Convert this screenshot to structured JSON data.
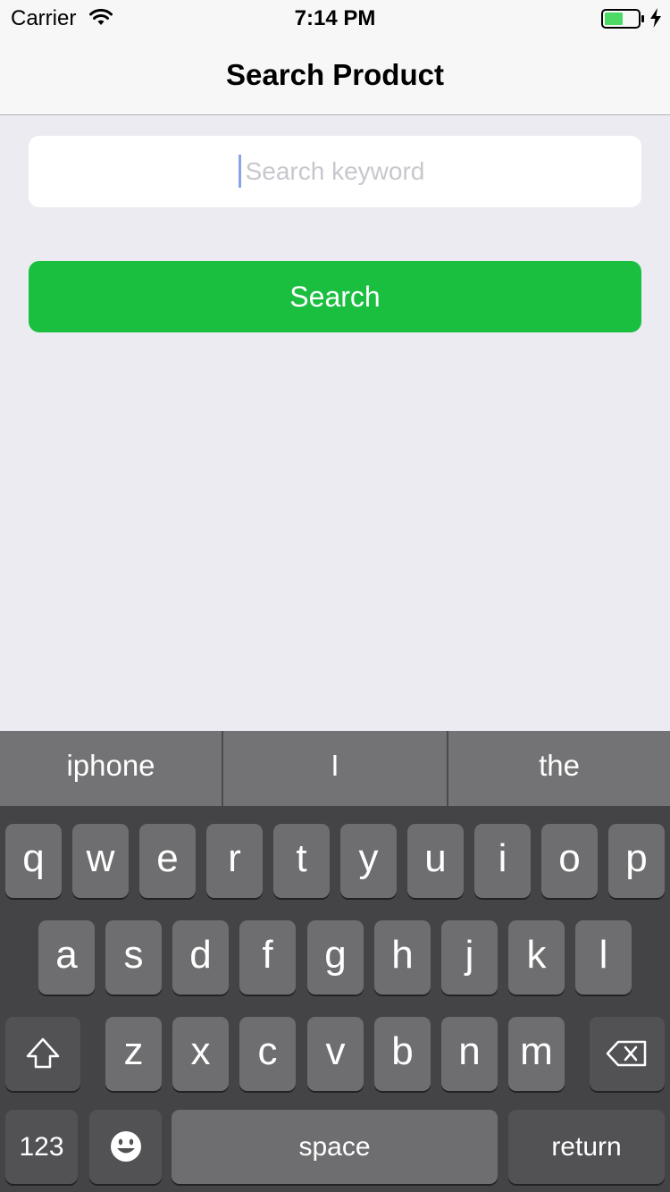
{
  "status_bar": {
    "carrier": "Carrier",
    "time": "7:14 PM",
    "icons": [
      "wifi-icon",
      "battery-icon",
      "charging-icon"
    ],
    "battery_color": "#4cd964"
  },
  "nav": {
    "title": "Search Product"
  },
  "search": {
    "placeholder": "Search keyword",
    "value": "",
    "button_label": "Search",
    "button_color": "#1bbf40"
  },
  "keyboard": {
    "suggestions": [
      "iphone",
      "I",
      "the"
    ],
    "row1": [
      "q",
      "w",
      "e",
      "r",
      "t",
      "y",
      "u",
      "i",
      "o",
      "p"
    ],
    "row2": [
      "a",
      "s",
      "d",
      "f",
      "g",
      "h",
      "j",
      "k",
      "l"
    ],
    "row3": [
      "z",
      "x",
      "c",
      "v",
      "b",
      "n",
      "m"
    ],
    "numbers_label": "123",
    "space_label": "space",
    "return_label": "return",
    "icons": [
      "shift-icon",
      "backspace-icon",
      "emoji-icon"
    ]
  }
}
